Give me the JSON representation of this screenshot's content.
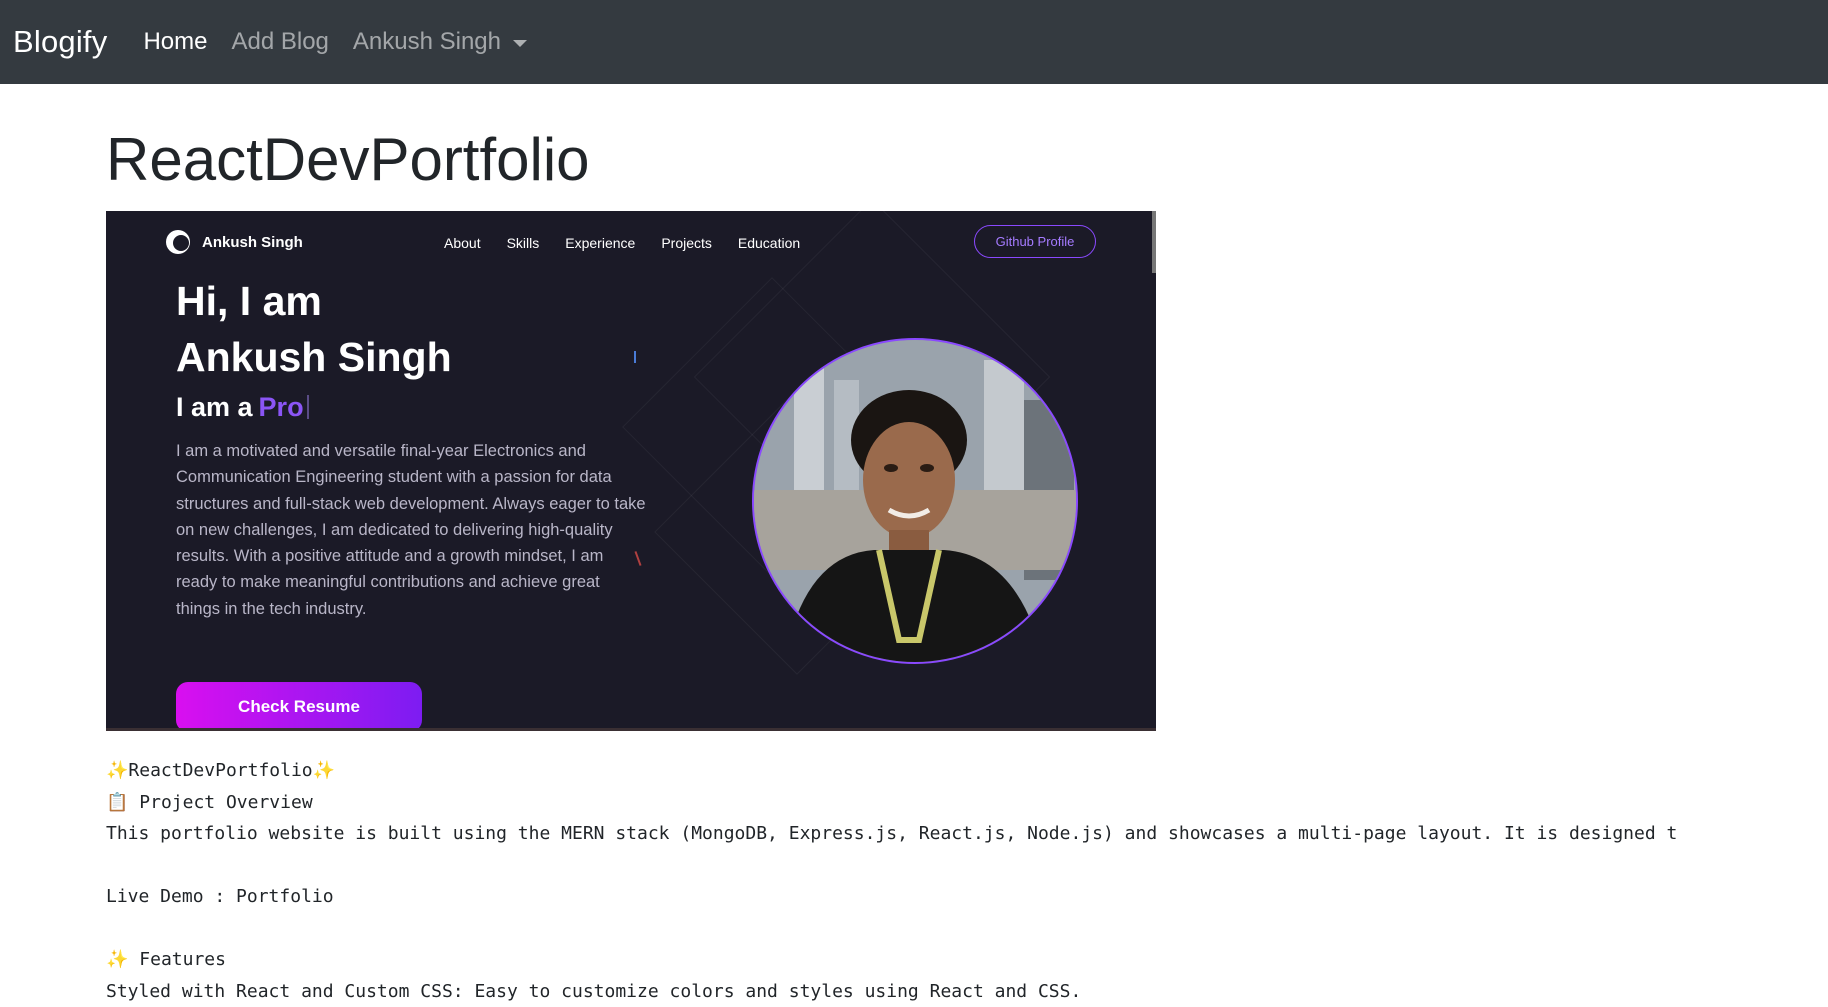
{
  "navbar": {
    "brand": "Blogify",
    "links": [
      "Home",
      "Add Blog"
    ],
    "user_menu": "Ankush Singh"
  },
  "post": {
    "title": "ReactDevPortfolio",
    "hero": {
      "logo_text": "Ankush Singh",
      "nav": [
        "About",
        "Skills",
        "Experience",
        "Projects",
        "Education"
      ],
      "github_button": "Github Profile",
      "greeting_line1": "Hi, I am",
      "greeting_line2": "Ankush Singh",
      "iam_prefix": "I am a",
      "iam_role": "Pro",
      "intro": "I am a motivated and versatile final-year Electronics and Communication Engineering student with a passion for data structures and full-stack web development. Always eager to take on new challenges, I am dedicated to delivering high-quality results. With a positive attitude and a growth mindset, I am ready to make meaningful contributions and achieve great things in the tech industry.",
      "resume_button": "Check Resume",
      "accent_color": "#8a49ff"
    },
    "body": {
      "heading": "✨ReactDevPortfolio✨",
      "overview_icon": "📋",
      "overview_title": "Project Overview",
      "overview_text": "This portfolio website is built using the MERN stack (MongoDB, Express.js, React.js, Node.js) and showcases a multi-page layout. It is designed t",
      "live_demo": "Live Demo : Portfolio",
      "features_icon": "✨",
      "features_title": "Features",
      "feature_1": "Styled with React and Custom CSS: Easy to customize colors and styles using React and CSS."
    }
  }
}
